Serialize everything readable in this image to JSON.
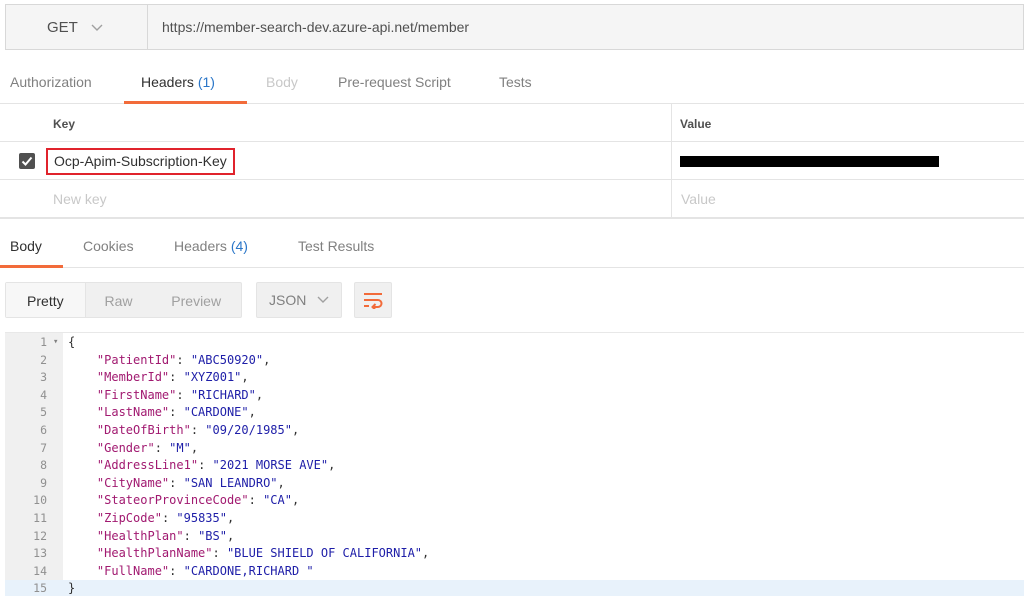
{
  "request": {
    "method": "GET",
    "url": "https://member-search-dev.azure-api.net/member"
  },
  "request_tabs": [
    {
      "label": "Authorization",
      "count": "",
      "state": "normal"
    },
    {
      "label": "Headers",
      "count": "(1)",
      "state": "active"
    },
    {
      "label": "Body",
      "count": "",
      "state": "disabled"
    },
    {
      "label": "Pre-request Script",
      "count": "",
      "state": "normal"
    },
    {
      "label": "Tests",
      "count": "",
      "state": "normal"
    }
  ],
  "headers_table": {
    "key_heading": "Key",
    "value_heading": "Value",
    "rows": [
      {
        "key": "Ocp-Apim-Subscription-Key",
        "value": "",
        "enabled": true,
        "value_redacted": true
      }
    ],
    "new_key_placeholder": "New key",
    "new_value_placeholder": "Value"
  },
  "response_tabs": [
    {
      "label": "Body",
      "count": "",
      "state": "active"
    },
    {
      "label": "Cookies",
      "count": "",
      "state": "normal"
    },
    {
      "label": "Headers",
      "count": "(4)",
      "state": "normal"
    },
    {
      "label": "Test Results",
      "count": "",
      "state": "normal"
    }
  ],
  "format": {
    "options": [
      "Pretty",
      "Raw",
      "Preview"
    ],
    "selected": "Pretty",
    "language": "JSON"
  },
  "response_body": {
    "lines": [
      {
        "n": "1",
        "text": "{"
      },
      {
        "n": "2",
        "key": "PatientId",
        "value": "ABC50920"
      },
      {
        "n": "3",
        "key": "MemberId",
        "value": "XYZ001"
      },
      {
        "n": "4",
        "key": "FirstName",
        "value": "RICHARD"
      },
      {
        "n": "5",
        "key": "LastName",
        "value": "CARDONE"
      },
      {
        "n": "6",
        "key": "DateOfBirth",
        "value": "09/20/1985"
      },
      {
        "n": "7",
        "key": "Gender",
        "value": "M"
      },
      {
        "n": "8",
        "key": "AddressLine1",
        "value": "2021 MORSE AVE"
      },
      {
        "n": "9",
        "key": "CityName",
        "value": "SAN LEANDRO"
      },
      {
        "n": "10",
        "key": "StateorProvinceCode",
        "value": "CA"
      },
      {
        "n": "11",
        "key": "ZipCode",
        "value": "95835"
      },
      {
        "n": "12",
        "key": "HealthPlan",
        "value": "BS"
      },
      {
        "n": "13",
        "key": "HealthPlanName",
        "value": "BLUE SHIELD OF CALIFORNIA"
      },
      {
        "n": "14",
        "key": "FullName",
        "value": "CARDONE,RICHARD ",
        "last": true
      },
      {
        "n": "15",
        "text": "}"
      }
    ]
  },
  "colors": {
    "accent": "#f26b3a",
    "count_blue": "#2a76c8",
    "highlight_box": "#e0232c",
    "json_key": "#a11970",
    "json_string": "#1e1ea8"
  }
}
